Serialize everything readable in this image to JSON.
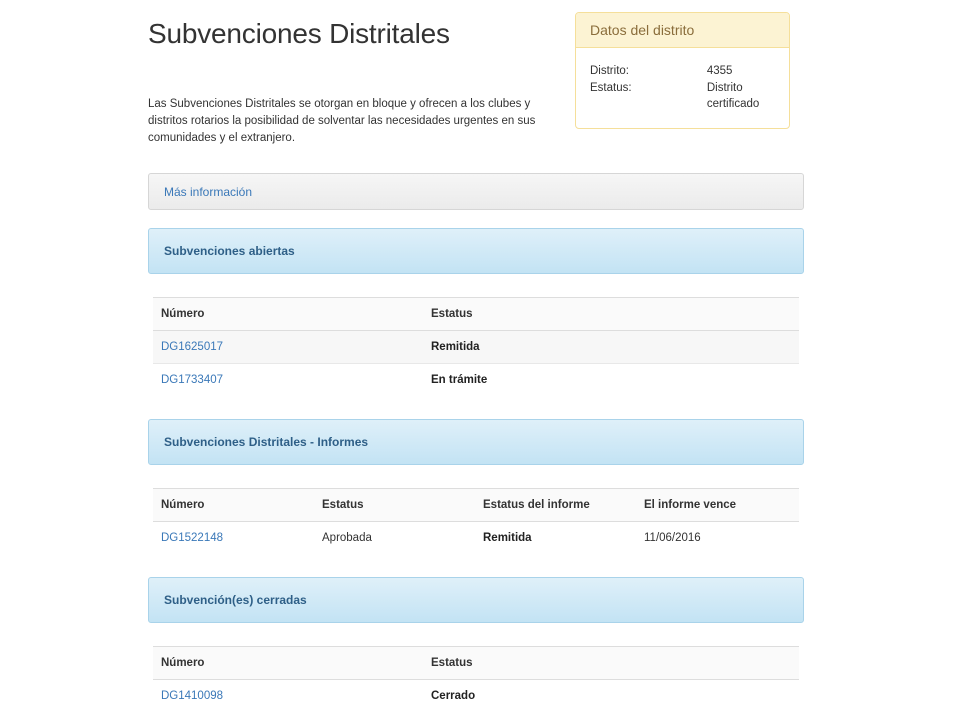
{
  "page": {
    "title": "Subvenciones Distritales",
    "intro": "Las Subvenciones Distritales se otorgan en bloque y ofrecen a los clubes y distritos rotarios la posibilidad de solventar las necesidades urgentes en sus comunidades y el extranjero."
  },
  "district_box": {
    "title": "Datos del distrito",
    "district_label": "Distrito:",
    "district_value": "4355",
    "status_label": "Estatus:",
    "status_value": "Distrito certificado"
  },
  "more_info": {
    "label": "Más información"
  },
  "open_grants": {
    "title": "Subvenciones abiertas",
    "columns": [
      "Número",
      "Estatus"
    ],
    "rows": [
      {
        "number": "DG1625017",
        "status": "Remitida"
      },
      {
        "number": "DG1733407",
        "status": "En trámite"
      }
    ]
  },
  "reports": {
    "title": "Subvenciones Distritales - Informes",
    "columns": [
      "Número",
      "Estatus",
      "Estatus del informe",
      "El informe vence"
    ],
    "rows": [
      {
        "number": "DG1522148",
        "status": "Aprobada",
        "report_status": "Remitida",
        "due": "11/06/2016"
      }
    ]
  },
  "closed_grants": {
    "title": "Subvención(es) cerradas",
    "columns": [
      "Número",
      "Estatus"
    ],
    "rows": [
      {
        "number": "DG1410098",
        "status": "Cerrado"
      }
    ]
  },
  "colors": {
    "link": "#3a78b8",
    "section_bar": "#c3e3f4",
    "district_header": "#fcf3d3"
  }
}
